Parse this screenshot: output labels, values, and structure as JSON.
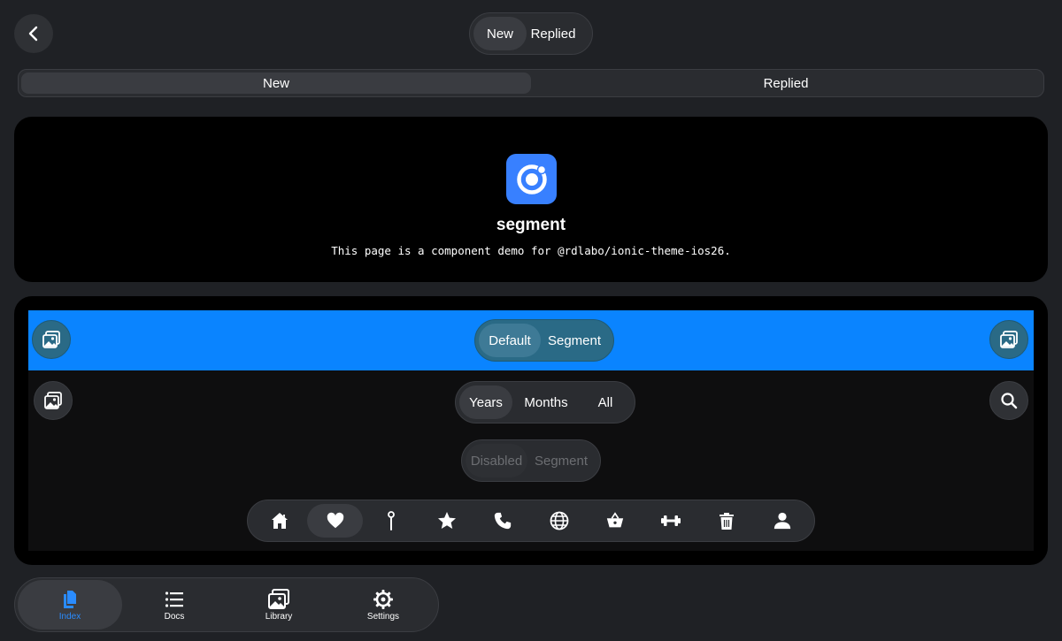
{
  "header": {
    "back_icon": "chevron-left-icon",
    "segment": {
      "items": [
        "New",
        "Replied"
      ],
      "selected": "New"
    }
  },
  "wide_segment": {
    "items": [
      "New",
      "Replied"
    ],
    "selected": "New"
  },
  "intro": {
    "logo_icon": "ionic-logo-icon",
    "title": "segment",
    "description": "This page is a component demo for @rdlabo/ionic-theme-ios26."
  },
  "demo": {
    "blue_toolbar": {
      "left_icon": "images-icon",
      "right_icon": "images-icon",
      "segment": {
        "items": [
          "Default",
          "Segment"
        ],
        "selected": "Default"
      }
    },
    "dark_toolbar": {
      "left_icon": "images-icon",
      "right_icon": "search-icon",
      "segment": {
        "items": [
          "Years",
          "Months",
          "All"
        ],
        "selected": "Years"
      }
    },
    "disabled_segment": {
      "items": [
        "Disabled",
        "Segment"
      ],
      "selected": "Disabled"
    },
    "icon_segment": {
      "items": [
        "home-icon",
        "heart-icon",
        "pin-icon",
        "star-icon",
        "call-icon",
        "globe-icon",
        "basket-icon",
        "barbell-icon",
        "trash-icon",
        "person-icon"
      ],
      "selected": "heart-icon"
    }
  },
  "tabbar": {
    "tabs": [
      {
        "label": "Index",
        "icon": "documents-icon"
      },
      {
        "label": "Docs",
        "icon": "list-icon"
      },
      {
        "label": "Library",
        "icon": "images-icon"
      },
      {
        "label": "Settings",
        "icon": "cog-icon"
      }
    ],
    "selected": "Index"
  },
  "colors": {
    "background": "#1f2125",
    "accent": "#2a8cff",
    "toolbar_blue": "#0a84ff",
    "logo_blue": "#3880ff"
  }
}
